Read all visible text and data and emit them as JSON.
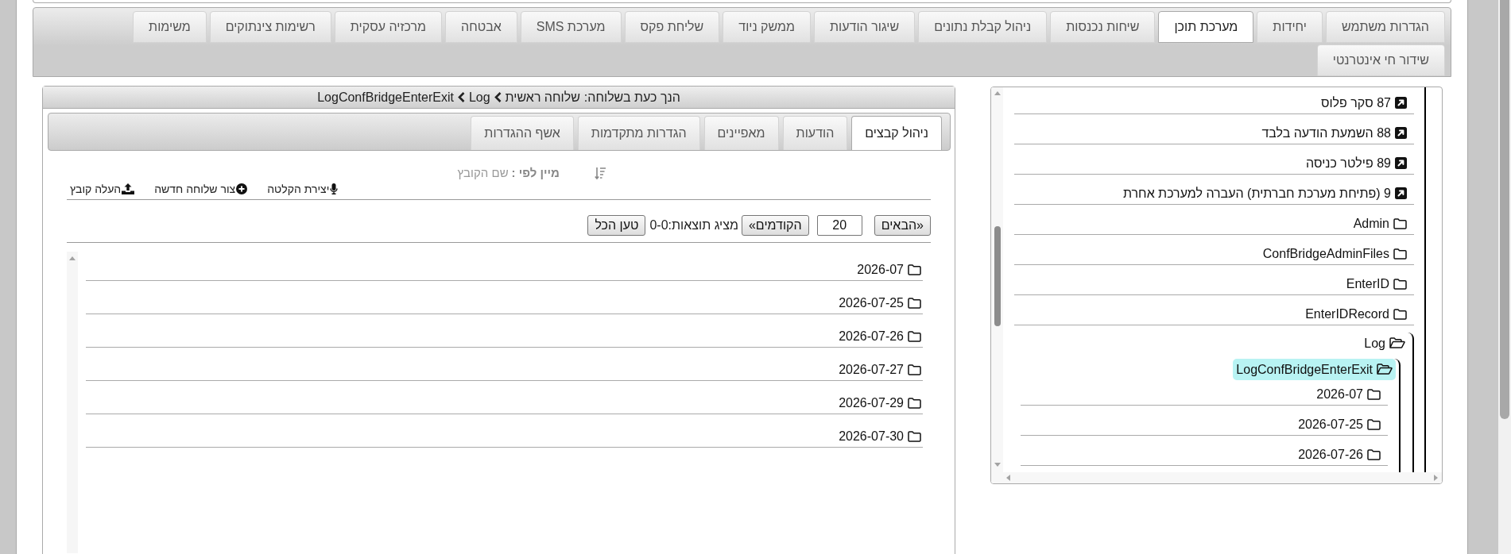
{
  "tabs": [
    {
      "label": "הגדרות משתמש",
      "selected": false
    },
    {
      "label": "יחידות",
      "selected": false
    },
    {
      "label": "מערכת תוכן",
      "selected": true
    },
    {
      "label": "שיחות נכנסות",
      "selected": false
    },
    {
      "label": "ניהול קבלת נתונים",
      "selected": false
    },
    {
      "label": "שיגור הודעות",
      "selected": false
    },
    {
      "label": "ממשק ניוד",
      "selected": false
    },
    {
      "label": "שליחת פקס",
      "selected": false
    },
    {
      "label": "מערכת SMS",
      "selected": false
    },
    {
      "label": "אבטחה",
      "selected": false
    },
    {
      "label": "מרכזיה עסקית",
      "selected": false
    },
    {
      "label": "רשימות צינתוקים",
      "selected": false
    },
    {
      "label": "משימות",
      "selected": false
    },
    {
      "label": "שידור חי אינטרנטי",
      "selected": false
    }
  ],
  "tree": {
    "items": [
      {
        "label": "87 סקר פלוס",
        "kind": "shortcut",
        "selected": false
      },
      {
        "label": "88 השמעת הודעה בלבד",
        "kind": "shortcut",
        "selected": false
      },
      {
        "label": "89 פילטר כניסה",
        "kind": "shortcut",
        "selected": false
      },
      {
        "label": "9 (פתיחת מערכת חברתית) העברה למערכת אחרת",
        "kind": "shortcut",
        "selected": false
      },
      {
        "label": "Admin",
        "kind": "folder",
        "expanded": false,
        "selected": false
      },
      {
        "label": "ConfBridgeAdminFiles",
        "kind": "folder",
        "expanded": false,
        "selected": false
      },
      {
        "label": "EnterID",
        "kind": "folder",
        "expanded": false,
        "selected": false
      },
      {
        "label": "EnterIDRecord",
        "kind": "folder",
        "expanded": false,
        "selected": false
      },
      {
        "label": "Log",
        "kind": "folder",
        "expanded": true,
        "selected": false,
        "children": [
          {
            "label": "LogConfBridgeEnterExit",
            "kind": "folder",
            "expanded": true,
            "selected": true,
            "children": [
              {
                "label": "2026-07",
                "kind": "folder",
                "expanded": false,
                "selected": false
              },
              {
                "label": "2026-07-25",
                "kind": "folder",
                "expanded": false,
                "selected": false
              },
              {
                "label": "2026-07-26",
                "kind": "folder",
                "expanded": false,
                "selected": false
              }
            ]
          }
        ]
      }
    ]
  },
  "panel": {
    "breadcrumb": {
      "prefix": "הנך כעת בשלוחה:",
      "path": [
        "שלוחה ראשית",
        "Log",
        "LogConfBridgeEnterExit"
      ]
    },
    "tabs": [
      {
        "label": "ניהול קבצים",
        "selected": true
      },
      {
        "label": "הודעות",
        "selected": false
      },
      {
        "label": "מאפיינים",
        "selected": false
      },
      {
        "label": "הגדרות מתקדמות",
        "selected": false
      },
      {
        "label": "אשף ההגדרות",
        "selected": false
      }
    ],
    "sort": {
      "label": "מיין לפי :",
      "value": "שם הקובץ"
    },
    "actions": [
      {
        "kind": "record",
        "label": "יצירת הקלטה"
      },
      {
        "kind": "new_extension",
        "label": "צור שלוחה חדשה"
      },
      {
        "kind": "upload",
        "label": "העלה קובץ"
      }
    ],
    "pagination": {
      "next": "«הבאים",
      "page_size": "20",
      "previous": "הקודמים»",
      "results": "מציג תוצאות:0-0",
      "load_all": "טען הכל"
    },
    "files": [
      "2026-07",
      "2026-07-25",
      "2026-07-26",
      "2026-07-27",
      "2026-07-29",
      "2026-07-30"
    ]
  }
}
